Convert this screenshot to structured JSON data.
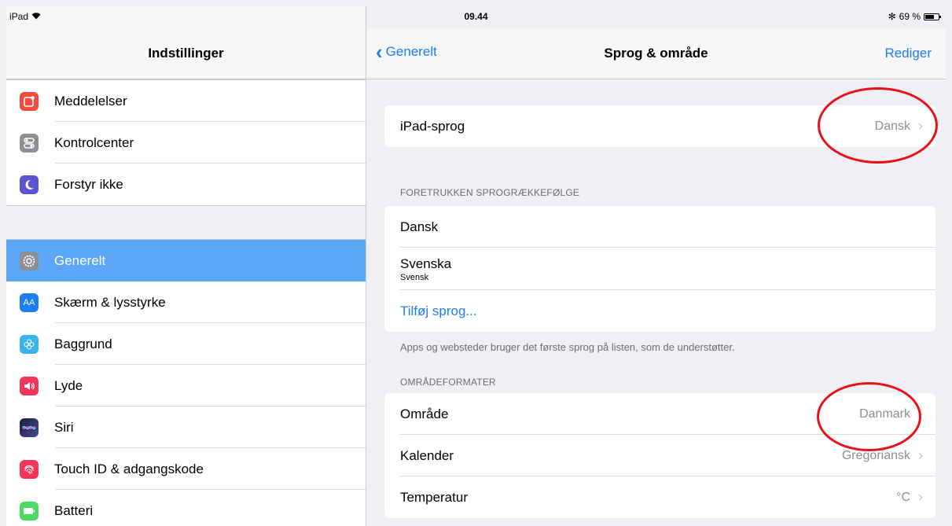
{
  "status": {
    "device": "iPad",
    "time": "09.44",
    "bluetooth": "✻",
    "battery": "69 %"
  },
  "left": {
    "title": "Indstillinger",
    "groups": [
      [
        {
          "label": "Meddelelser",
          "color": "#f14a3e",
          "icon": "notifications-icon"
        },
        {
          "label": "Kontrolcenter",
          "color": "#8e8e93",
          "icon": "control-center-icon"
        },
        {
          "label": "Forstyr ikke",
          "color": "#5b55d6",
          "icon": "moon-icon"
        }
      ],
      [
        {
          "label": "Generelt",
          "color": "#8e8e93",
          "icon": "gear-icon",
          "selected": true
        },
        {
          "label": "Skærm & lysstyrke",
          "color": "#1e7cf5",
          "icon": "display-icon"
        },
        {
          "label": "Baggrund",
          "color": "#38b5e8",
          "icon": "wallpaper-icon"
        },
        {
          "label": "Lyde",
          "color": "#f1365a",
          "icon": "speaker-icon"
        },
        {
          "label": "Siri",
          "color": "#2a2a55",
          "icon": "siri-icon"
        },
        {
          "label": "Touch ID & adgangskode",
          "color": "#f1365a",
          "icon": "fingerprint-icon"
        },
        {
          "label": "Batteri",
          "color": "#4cd964",
          "icon": "battery-icon"
        }
      ]
    ]
  },
  "right": {
    "back": "Generelt",
    "title": "Sprog & område",
    "edit": "Rediger",
    "device_language": {
      "label": "iPad-sprog",
      "value": "Dansk"
    },
    "preferred_header": "FORETRUKKEN SPROGRÆKKEFØLGE",
    "languages": [
      {
        "name": "Dansk"
      },
      {
        "name": "Svenska",
        "sub": "Svensk"
      }
    ],
    "add_language": "Tilføj sprog...",
    "preferred_footer": "Apps og websteder bruger det første sprog på listen, som de understøtter.",
    "region_header": "OMRÅDEFORMATER",
    "region_rows": [
      {
        "label": "Område",
        "value": "Danmark"
      },
      {
        "label": "Kalender",
        "value": "Gregoriansk"
      },
      {
        "label": "Temperatur",
        "value": "°C"
      }
    ]
  }
}
